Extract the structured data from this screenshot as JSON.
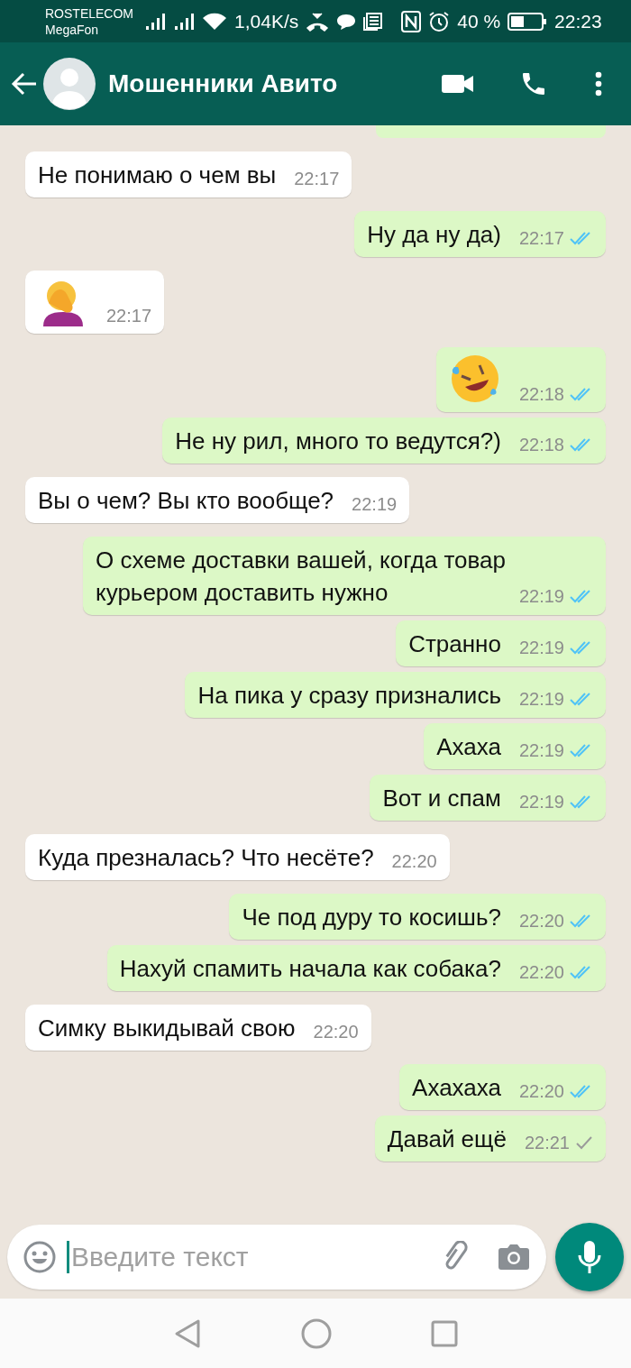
{
  "status_bar": {
    "carriers": [
      "ROSTELECOM",
      "MegaFon"
    ],
    "speed": "1,04K/s",
    "battery": "40 %",
    "time": "22:23"
  },
  "header": {
    "title": "Мошенники Авито"
  },
  "messages": [
    {
      "outgoing": false,
      "kind": "text",
      "text": "Не понимаю о чем вы",
      "time": "22:17"
    },
    {
      "outgoing": true,
      "kind": "text",
      "text": "Ну да ну да)",
      "time": "22:17",
      "read": true
    },
    {
      "outgoing": false,
      "kind": "facepalm",
      "time": "22:17"
    },
    {
      "outgoing": true,
      "kind": "laughing",
      "time": "22:18",
      "read": true
    },
    {
      "outgoing": true,
      "kind": "text",
      "text": "Не ну рил, много то ведутся?)",
      "time": "22:18",
      "read": true
    },
    {
      "outgoing": false,
      "kind": "text",
      "text": "Вы о чем? Вы кто вообще?",
      "time": "22:19"
    },
    {
      "outgoing": true,
      "kind": "text",
      "text": "О схеме доставки вашей, когда товар курьером доставить нужно",
      "time": "22:19",
      "read": true
    },
    {
      "outgoing": true,
      "kind": "text",
      "text": "Странно",
      "time": "22:19",
      "read": true
    },
    {
      "outgoing": true,
      "kind": "text",
      "text": "На пика у сразу признались",
      "time": "22:19",
      "read": true
    },
    {
      "outgoing": true,
      "kind": "text",
      "text": "Ахаха",
      "time": "22:19",
      "read": true
    },
    {
      "outgoing": true,
      "kind": "text",
      "text": "Вот и спам",
      "time": "22:19",
      "read": true
    },
    {
      "outgoing": false,
      "kind": "text",
      "text": "Куда презналась? Что несёте?",
      "time": "22:20"
    },
    {
      "outgoing": true,
      "kind": "text",
      "text": "Че под дуру то косишь?",
      "time": "22:20",
      "read": true
    },
    {
      "outgoing": true,
      "kind": "text",
      "text": "Нахуй спамить начала как собака?",
      "time": "22:20",
      "read": true
    },
    {
      "outgoing": false,
      "kind": "text",
      "text": "Симку выкидывай свою",
      "time": "22:20"
    },
    {
      "outgoing": true,
      "kind": "text",
      "text": "Ахахаха",
      "time": "22:20",
      "read": true
    },
    {
      "outgoing": true,
      "kind": "text",
      "text": "Давай ещё",
      "time": "22:21",
      "read": false
    }
  ],
  "composer": {
    "placeholder": "Введите текст"
  }
}
